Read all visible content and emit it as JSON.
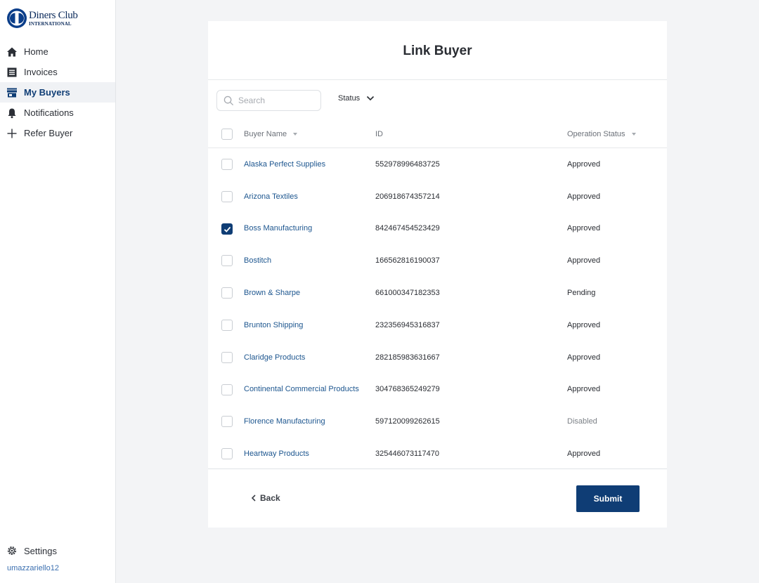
{
  "brand": {
    "line1": "Diners Club",
    "line2": "INTERNATIONAL"
  },
  "sidebar": {
    "items": [
      {
        "label": "Home",
        "icon": "home-icon"
      },
      {
        "label": "Invoices",
        "icon": "document-icon"
      },
      {
        "label": "My Buyers",
        "icon": "store-icon",
        "active": true
      },
      {
        "label": "Notifications",
        "icon": "bell-icon"
      },
      {
        "label": "Refer Buyer",
        "icon": "plus-icon"
      }
    ],
    "settings_label": "Settings",
    "username": "umazzariello12"
  },
  "page": {
    "title": "Link Buyer"
  },
  "toolbar": {
    "search_placeholder": "Search",
    "status_filter_label": "Status"
  },
  "table": {
    "columns": {
      "name": "Buyer Name",
      "id": "ID",
      "status": "Operation Status"
    },
    "rows": [
      {
        "name": "Alaska Perfect Supplies",
        "id": "552978996483725",
        "status": "Approved",
        "checked": false
      },
      {
        "name": "Arizona Textiles",
        "id": "206918674357214",
        "status": "Approved",
        "checked": false
      },
      {
        "name": "Boss Manufacturing",
        "id": "842467454523429",
        "status": "Approved",
        "checked": true
      },
      {
        "name": "Bostitch",
        "id": "166562816190037",
        "status": "Approved",
        "checked": false
      },
      {
        "name": "Brown & Sharpe",
        "id": "661000347182353",
        "status": "Pending",
        "checked": false
      },
      {
        "name": "Brunton Shipping",
        "id": "232356945316837",
        "status": "Approved",
        "checked": false
      },
      {
        "name": "Claridge Products",
        "id": "282185983631667",
        "status": "Approved",
        "checked": false
      },
      {
        "name": "Continental Commercial Products",
        "id": "304768365249279",
        "status": "Approved",
        "checked": false
      },
      {
        "name": "Florence Manufacturing",
        "id": "597120099262615",
        "status": "Disabled",
        "checked": false
      },
      {
        "name": "Heartway Products",
        "id": "325446073117470",
        "status": "Approved",
        "checked": false
      }
    ]
  },
  "footer": {
    "back_label": "Back",
    "submit_label": "Submit"
  },
  "colors": {
    "primary": "#0f3d75",
    "link": "#1d568f"
  }
}
